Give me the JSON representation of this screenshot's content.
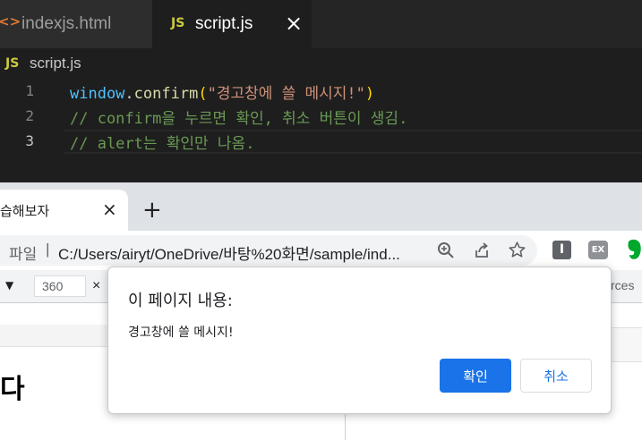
{
  "editor": {
    "tabs": [
      {
        "icon_text": "<>",
        "label": "indexjs.html"
      },
      {
        "icon_text": "JS",
        "label": "script.js",
        "close": "×"
      }
    ],
    "breadcrumb": {
      "icon_text": "JS",
      "label": "script.js"
    },
    "lines": [
      {
        "number": "1"
      },
      {
        "number": "2",
        "text": "// confirm을 누르면 확인, 취소 버튼이 생김."
      },
      {
        "number": "3",
        "text": "// alert는 확인만 나옴."
      }
    ],
    "line1": {
      "obj": "window",
      "dot": ".",
      "fn": "confirm",
      "open": "(",
      "str": "\"경고창에 쓸 메시지!\"",
      "close": ")"
    }
  },
  "browser": {
    "tab_title": "습해보자",
    "tab_close": "×",
    "new_tab": "+",
    "address_prefix": "파일",
    "address_sep": "|",
    "address_url": "C:/Users/airyt/OneDrive/바탕%20화면/sample/ind...",
    "ext_icons": [
      "I",
      "EX"
    ],
    "devtools": {
      "dropdown_arrow": "▼",
      "width_value": "360",
      "times": "×",
      "sources_label": "rces"
    },
    "page_heading": "다"
  },
  "dialog": {
    "title": "이 페이지 내용:",
    "message": "경고창에 쓸 메시지!",
    "ok_label": "확인",
    "cancel_label": "취소"
  },
  "colors": {
    "accent": "#1a73e8",
    "keyword": "#9cdcfe",
    "function": "#dcdcaa",
    "string": "#ce9178",
    "comment": "#6a9955"
  }
}
